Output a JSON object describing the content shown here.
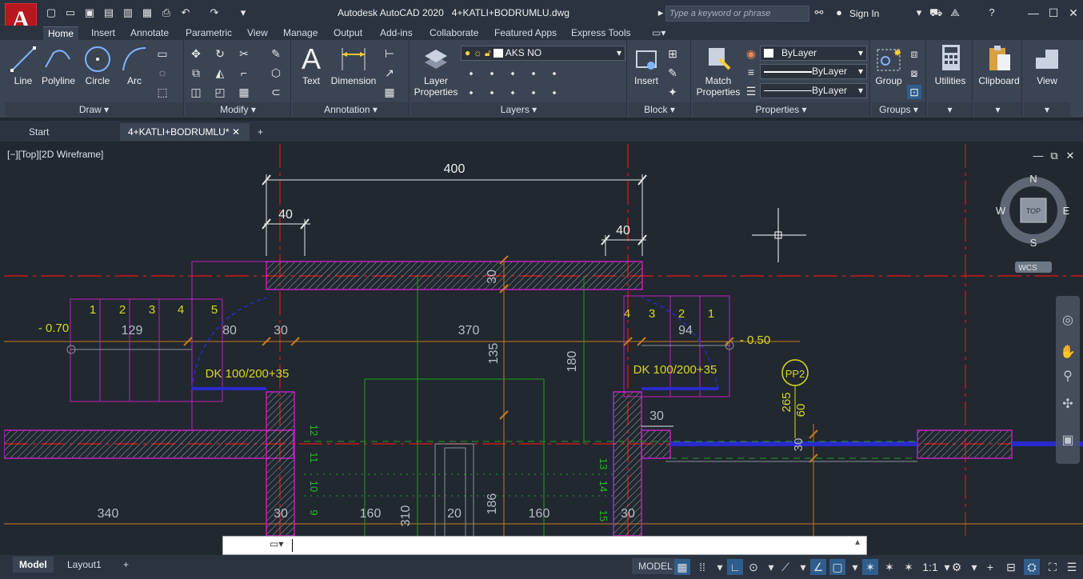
{
  "app": {
    "title": "Autodesk AutoCAD 2020",
    "filename": "4+KATLI+BODRUMLU.dwg",
    "logo_letter": "A"
  },
  "search": {
    "placeholder": "Type a keyword or phrase"
  },
  "signin": {
    "label": "Sign In"
  },
  "ribbon_tabs": [
    "Home",
    "Insert",
    "Annotate",
    "Parametric",
    "View",
    "Manage",
    "Output",
    "Add-ins",
    "Collaborate",
    "Featured Apps",
    "Express Tools"
  ],
  "draw": {
    "panel_title": "Draw",
    "line": "Line",
    "polyline": "Polyline",
    "circle": "Circle",
    "arc": "Arc"
  },
  "modify": {
    "panel_title": "Modify"
  },
  "annotation": {
    "panel_title": "Annotation",
    "text": "Text",
    "dimension": "Dimension"
  },
  "layers": {
    "panel_title": "Layers",
    "layer_properties_1": "Layer",
    "layer_properties_2": "Properties",
    "current_layer": "AKS NO"
  },
  "block": {
    "panel_title": "Block",
    "insert": "Insert"
  },
  "properties": {
    "panel_title": "Properties",
    "match_1": "Match",
    "match_2": "Properties",
    "color": "ByLayer",
    "linetype": "ByLayer",
    "lineweight": "ByLayer"
  },
  "groups": {
    "panel_title": "Groups",
    "group": "Group"
  },
  "utilities": {
    "label": "Utilities"
  },
  "clipboard": {
    "label": "Clipboard"
  },
  "view": {
    "label": "View"
  },
  "file_tabs": {
    "start": "Start",
    "current": "4+KATLI+BODRUMLU*"
  },
  "viewport_label": "[−][Top][2D Wireframe]",
  "viewcube": {
    "n": "N",
    "s": "S",
    "e": "E",
    "w": "W",
    "top": "TOP",
    "wcs": "WCS"
  },
  "drawing": {
    "dims_white": [
      "400",
      "40",
      "40",
      "129",
      "80",
      "30",
      "370",
      "94",
      "135",
      "180",
      "30",
      "340",
      "30",
      "160",
      "310",
      "20",
      "186",
      "160",
      "30",
      "30"
    ],
    "levels": [
      "- 0.70",
      "- 0.50"
    ],
    "door_left": "DK 100/200+35",
    "door_right": "DK 100/200+35",
    "steps_left": [
      "1",
      "2",
      "3",
      "4",
      "5"
    ],
    "steps_right": [
      "4",
      "3",
      "2",
      "1"
    ],
    "pp_label": "PP2",
    "pp_dims": [
      "265",
      "60"
    ],
    "green_left": [
      "12",
      "11",
      "10",
      "9"
    ],
    "green_right": [
      "13",
      "14",
      "15"
    ]
  },
  "status": {
    "model_tab": "Model",
    "layout_tab": "Layout1",
    "model_button": "MODEL",
    "scale": "1:1"
  },
  "colors": {
    "accent": "#2f5e8d",
    "magenta": "#c21ec2",
    "red": "#c8191a",
    "orange": "#c87a1e",
    "yellow": "#d8d81e",
    "green": "#1ea01e",
    "blue": "#2a2acc"
  }
}
